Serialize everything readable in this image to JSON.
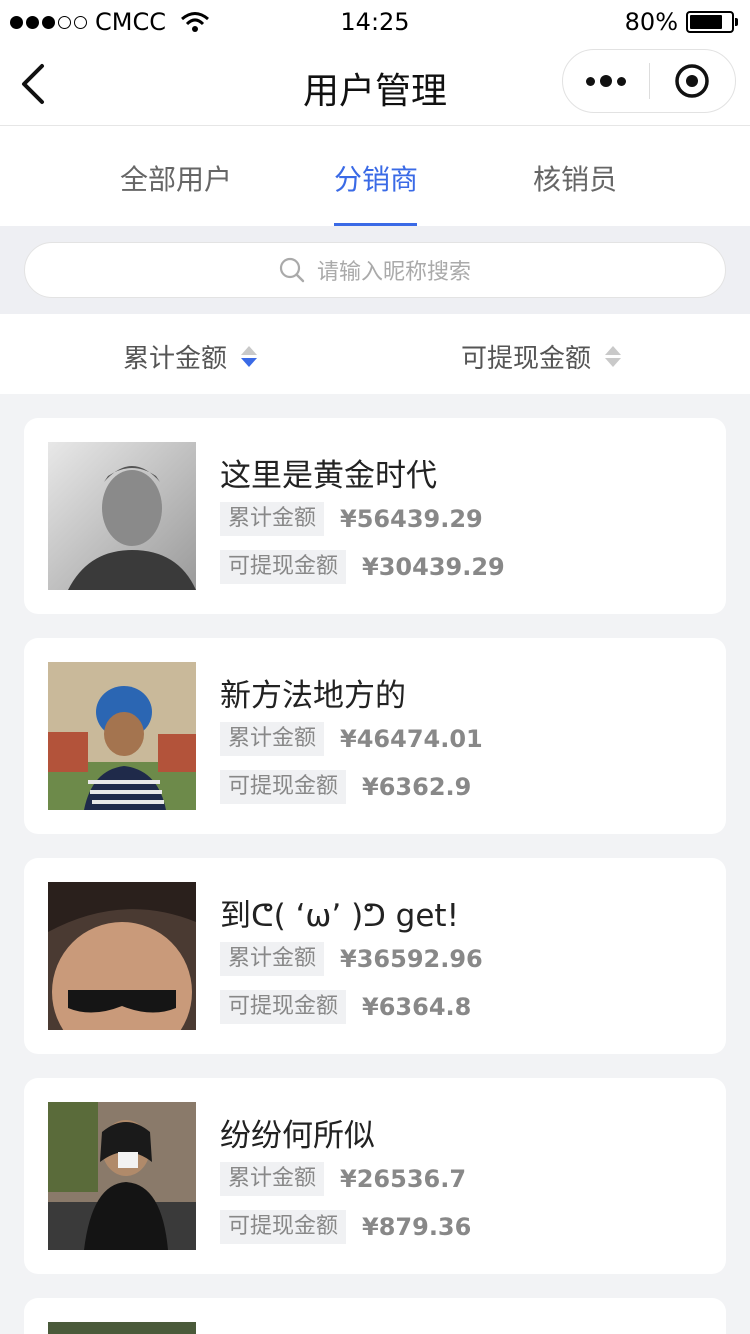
{
  "status_bar": {
    "carrier": "CMCC",
    "time": "14:25",
    "battery": "80%"
  },
  "nav": {
    "title": "用户管理"
  },
  "tabs": [
    {
      "label": "全部用户",
      "active": false
    },
    {
      "label": "分销商",
      "active": true
    },
    {
      "label": "核销员",
      "active": false
    }
  ],
  "search": {
    "placeholder": "请输入昵称搜索"
  },
  "sort": {
    "total_label": "累计金额",
    "withdrawable_label": "可提现金额"
  },
  "users": [
    {
      "name": "这里是黄金时代",
      "total_label": "累计金额",
      "total": "¥56439.29",
      "withdrawable_label": "可提现金额",
      "withdrawable": "¥30439.29"
    },
    {
      "name": "新方法地方的",
      "total_label": "累计金额",
      "total": "¥46474.01",
      "withdrawable_label": "可提现金额",
      "withdrawable": "¥6362.9"
    },
    {
      "name": "到ᕦ( ‘ω’ )ᕤ get!",
      "total_label": "累计金额",
      "total": "¥36592.96",
      "withdrawable_label": "可提现金额",
      "withdrawable": "¥6364.8"
    },
    {
      "name": "纷纷何所似",
      "total_label": "累计金额",
      "total": "¥26536.7",
      "withdrawable_label": "可提现金额",
      "withdrawable": "¥879.36"
    }
  ],
  "colors": {
    "accent": "#3a6ae6",
    "background": "#f2f3f5",
    "tag_bg": "#f0f1f3",
    "muted": "#888888"
  }
}
